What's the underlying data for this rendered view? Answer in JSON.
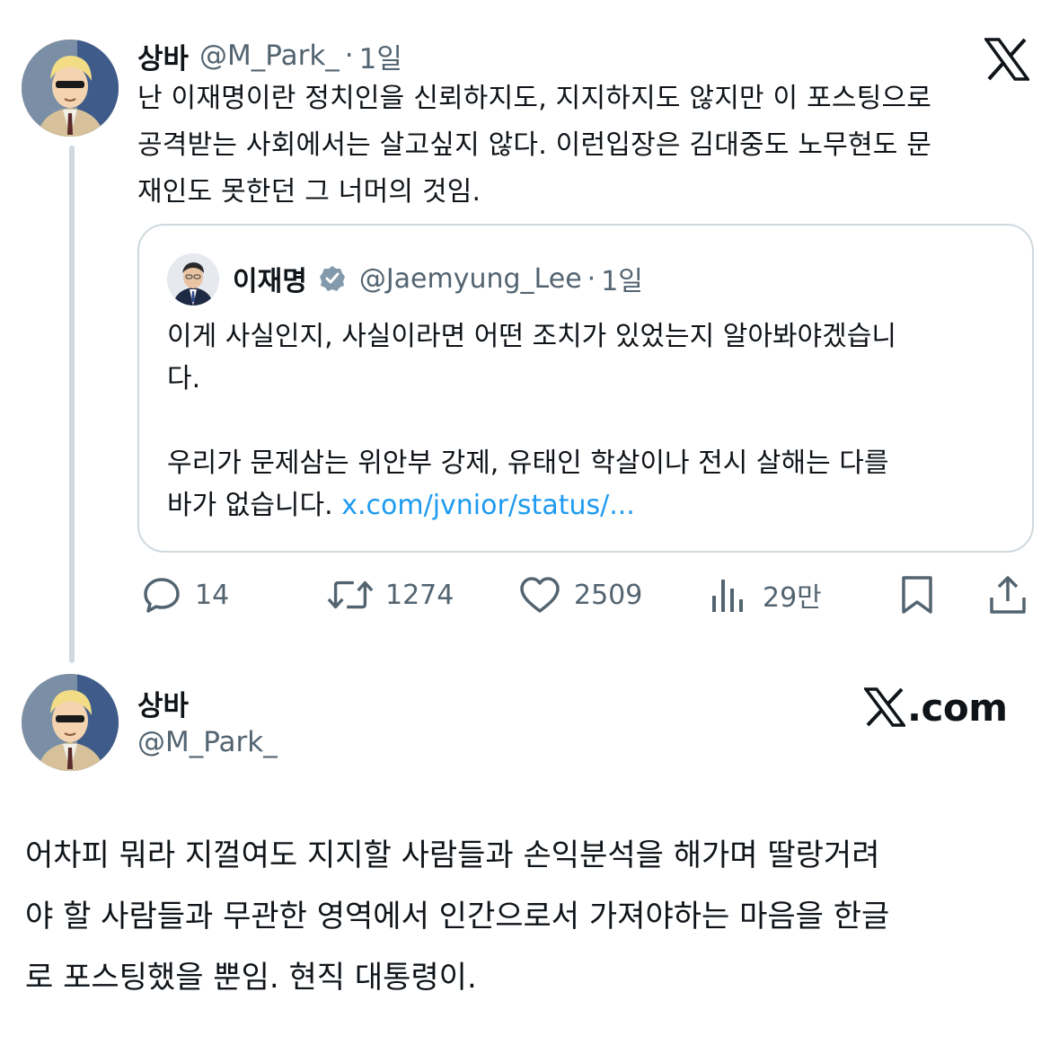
{
  "main_tweet": {
    "author_name": "상바",
    "author_handle": "@M_Park_",
    "separator": "·",
    "time": "1일",
    "text_lines": [
      "난 이재명이란 정치인을 신뢰하지도, 지지하지도 않지만 이 포스팅으로",
      "공격받는 사회에서는 살고싶지 않다. 이런입장은 김대중도 노무현도 문",
      "재인도 못한던 그 너머의 것임."
    ]
  },
  "quoted_tweet": {
    "author_name": "이재명",
    "author_handle": "@Jaemyung_Lee",
    "separator": "·",
    "time": "1일",
    "paragraph1_lines": [
      "이게 사실인지, 사실이라면 어떤 조치가 있었는지 알아봐야겠습니",
      "다."
    ],
    "paragraph2_lines": [
      "우리가 문제삼는 위안부 강제, 유태인 학살이나 전시 살해는 다를",
      "바가 없습니다. "
    ],
    "link_text": "x.com/jvnior/status/..."
  },
  "actions": {
    "reply_count": "14",
    "retweet_count": "1274",
    "like_count": "2509",
    "view_count": "29만"
  },
  "reply_tweet": {
    "author_name": "상바",
    "author_handle": "@M_Park_",
    "source_label": ".com"
  },
  "comment_lines": [
    "어차피 뭐라 지껄여도 지지할 사람들과 손익분석을 해가며 딸랑거려",
    "야 할 사람들과 무관한 영역에서 인간으로서 가져야하는 마음을 한글",
    "로 포스팅했을 뿐임. 현직 대통령이."
  ],
  "colors": {
    "text": "#0f1419",
    "secondary": "#536471",
    "link": "#1d9bf0",
    "border": "#cfd9de"
  },
  "icons": [
    "x-logo-icon",
    "verified-badge-icon",
    "reply-icon",
    "retweet-icon",
    "like-icon",
    "views-icon",
    "bookmark-icon",
    "share-icon"
  ]
}
